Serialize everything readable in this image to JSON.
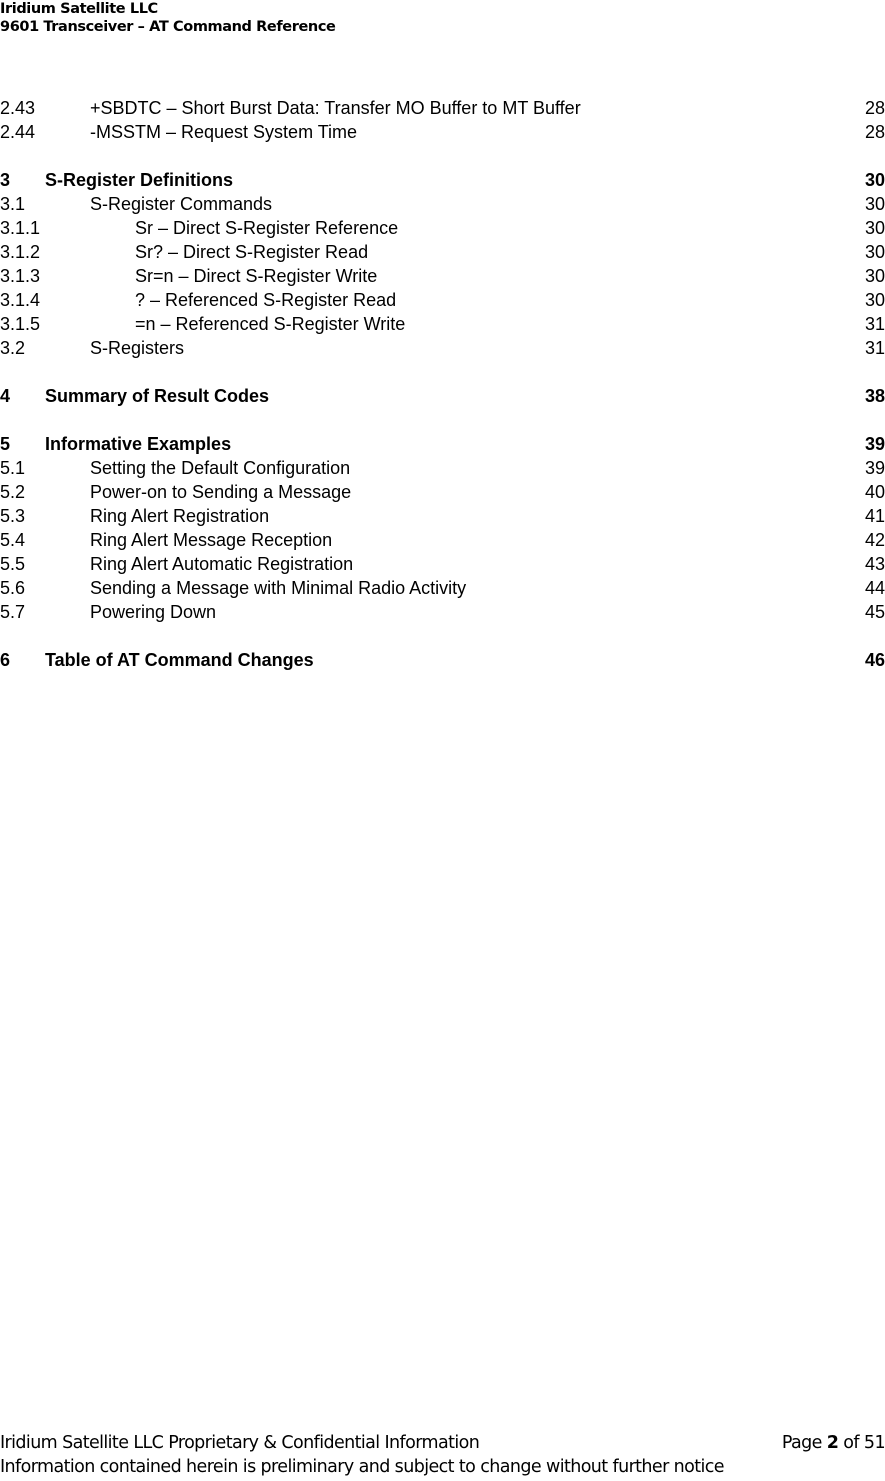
{
  "header": {
    "company": "Iridium Satellite LLC",
    "document_title": "9601 Transceiver – AT Command Reference"
  },
  "toc": {
    "entries": [
      {
        "number": "2.43",
        "title": "+SBDTC – Short Burst Data: Transfer MO Buffer to MT Buffer",
        "page": "28",
        "level": 2,
        "gap_before": false
      },
      {
        "number": "2.44",
        "title": "-MSSTM – Request System Time",
        "page": "28",
        "level": 2,
        "gap_before": false
      },
      {
        "number": "3",
        "title": "S-Register Definitions",
        "page": "30",
        "level": 1,
        "gap_before": true
      },
      {
        "number": "3.1",
        "title": "S-Register Commands",
        "page": "30",
        "level": 2,
        "gap_before": false
      },
      {
        "number": "3.1.1",
        "title": "Sr – Direct S-Register Reference",
        "page": "30",
        "level": 3,
        "gap_before": false
      },
      {
        "number": "3.1.2",
        "title": "Sr? – Direct S-Register Read",
        "page": "30",
        "level": 3,
        "gap_before": false
      },
      {
        "number": "3.1.3",
        "title": "Sr=n – Direct S-Register Write",
        "page": "30",
        "level": 3,
        "gap_before": false
      },
      {
        "number": "3.1.4",
        "title": "? – Referenced S-Register Read",
        "page": "30",
        "level": 3,
        "gap_before": false
      },
      {
        "number": "3.1.5",
        "title": "=n – Referenced S-Register Write",
        "page": "31",
        "level": 3,
        "gap_before": false
      },
      {
        "number": "3.2",
        "title": "S-Registers",
        "page": "31",
        "level": 2,
        "gap_before": false
      },
      {
        "number": "4",
        "title": "Summary of Result Codes",
        "page": "38",
        "level": 1,
        "gap_before": true
      },
      {
        "number": "5",
        "title": "Informative Examples",
        "page": "39",
        "level": 1,
        "gap_before": true
      },
      {
        "number": "5.1",
        "title": "Setting the Default Configuration",
        "page": "39",
        "level": 2,
        "gap_before": false
      },
      {
        "number": "5.2",
        "title": "Power-on to Sending a Message",
        "page": "40",
        "level": 2,
        "gap_before": false
      },
      {
        "number": "5.3",
        "title": "Ring Alert Registration",
        "page": "41",
        "level": 2,
        "gap_before": false
      },
      {
        "number": "5.4",
        "title": "Ring Alert Message Reception",
        "page": "42",
        "level": 2,
        "gap_before": false
      },
      {
        "number": "5.5",
        "title": "Ring Alert Automatic Registration",
        "page": "43",
        "level": 2,
        "gap_before": false
      },
      {
        "number": "5.6",
        "title": "Sending a Message with Minimal Radio Activity",
        "page": "44",
        "level": 2,
        "gap_before": false
      },
      {
        "number": "5.7",
        "title": "Powering Down",
        "page": "45",
        "level": 2,
        "gap_before": false
      },
      {
        "number": "6",
        "title": "Table of AT Command Changes",
        "page": "46",
        "level": 1,
        "gap_before": true
      }
    ]
  },
  "footer": {
    "confidential_notice": "Iridium Satellite LLC Proprietary & Confidential Information",
    "page_prefix": "Page ",
    "page_current": "2",
    "page_separator": " of ",
    "page_total": "51",
    "disclaimer": "Information contained herein is preliminary and subject to change without further notice"
  }
}
